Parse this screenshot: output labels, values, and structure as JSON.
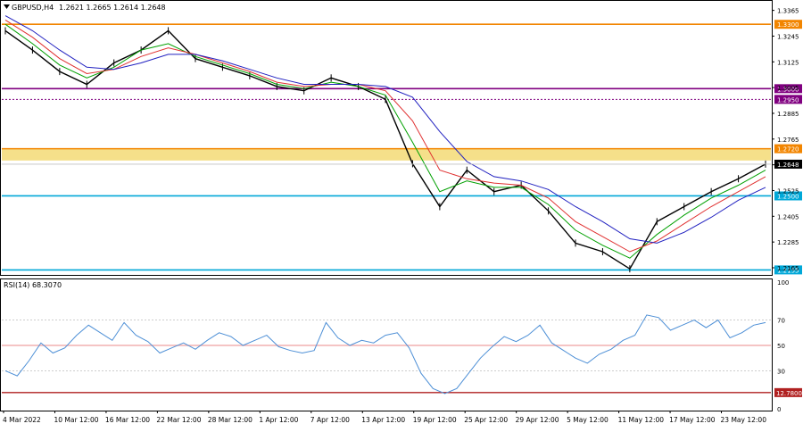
{
  "header": {
    "symbol": "GBPUSD,H4",
    "ohlc": "1.2621 1.2665 1.2614 1.2648"
  },
  "chart_data": [
    {
      "type": "line",
      "title": "GBPUSD,H4",
      "x": [
        "4 Mar 2022",
        "10 Mar 12:00",
        "16 Mar 12:00",
        "22 Mar 12:00",
        "28 Mar 12:00",
        "1 Apr 12:00",
        "7 Apr 12:00",
        "13 Apr 12:00",
        "19 Apr 12:00",
        "25 Apr 12:00",
        "29 Apr 12:00",
        "5 May 12:00",
        "11 May 12:00",
        "17 May 12:00",
        "23 May 12:00"
      ],
      "series": [
        {
          "type": "candlestick",
          "values": [
            1.327,
            1.318,
            1.308,
            1.302,
            1.312,
            1.318,
            1.327,
            1.314,
            1.31,
            1.306,
            1.301,
            1.299,
            1.305,
            1.301,
            1.295,
            1.265,
            1.245,
            1.262,
            1.252,
            1.255,
            1.243,
            1.228,
            1.224,
            1.216,
            1.238,
            1.245,
            1.252,
            1.258,
            1.2648
          ],
          "color": "#000000"
        },
        {
          "type": "moving-average",
          "color": "#00a000",
          "values": [
            1.33,
            1.321,
            1.311,
            1.305,
            1.31,
            1.318,
            1.321,
            1.315,
            1.311,
            1.307,
            1.302,
            1.3,
            1.303,
            1.301,
            1.297,
            1.275,
            1.252,
            1.257,
            1.254,
            1.254,
            1.246,
            1.234,
            1.227,
            1.221,
            1.232,
            1.241,
            1.249,
            1.255,
            1.262
          ]
        },
        {
          "type": "moving-average",
          "color": "#e03030",
          "values": [
            1.332,
            1.324,
            1.314,
            1.307,
            1.309,
            1.315,
            1.319,
            1.316,
            1.312,
            1.308,
            1.303,
            1.301,
            1.302,
            1.302,
            1.299,
            1.285,
            1.262,
            1.258,
            1.256,
            1.255,
            1.249,
            1.238,
            1.231,
            1.224,
            1.229,
            1.237,
            1.245,
            1.252,
            1.259
          ]
        },
        {
          "type": "moving-average",
          "color": "#2020c0",
          "values": [
            1.334,
            1.327,
            1.318,
            1.31,
            1.309,
            1.312,
            1.316,
            1.316,
            1.313,
            1.309,
            1.305,
            1.302,
            1.302,
            1.302,
            1.301,
            1.296,
            1.28,
            1.266,
            1.259,
            1.257,
            1.253,
            1.245,
            1.238,
            1.23,
            1.228,
            1.233,
            1.24,
            1.248,
            1.254
          ]
        }
      ],
      "y_ticks": [
        "1.3365",
        "1.3245",
        "1.3125",
        "1.3005",
        "1.2885",
        "1.2765",
        "1.2645",
        "1.2525",
        "1.2405",
        "1.2285",
        "1.2165"
      ],
      "ylim": [
        1.214,
        1.3405
      ],
      "levels": [
        {
          "label": "1.3300",
          "value": 1.33,
          "color": "#f28500"
        },
        {
          "label": "1.3000",
          "value": 1.3,
          "color": "#800080"
        },
        {
          "label": "1.2950",
          "value": 1.295,
          "color": "#800080",
          "style": "dotted"
        },
        {
          "label": "1.2720",
          "value": 1.272,
          "color": "#f28500"
        },
        {
          "label": "1.2500",
          "value": 1.25,
          "color": "#00a8d8"
        },
        {
          "label": "1.2155",
          "value": 1.2155,
          "color": "#00a8d8"
        }
      ],
      "zone": {
        "from": 1.2665,
        "to": 1.272,
        "color": "#f5e08a"
      },
      "price_label": "1.2648",
      "price_value": 1.2648,
      "grid": false
    },
    {
      "type": "line",
      "title": "RSI(14) 68.3070",
      "series": [
        {
          "name": "RSI(14)",
          "color": "#4d8fd6",
          "values": [
            30,
            26,
            38,
            52,
            44,
            48,
            58,
            66,
            60,
            54,
            68,
            58,
            53,
            44,
            48,
            52,
            47,
            54,
            60,
            57,
            50,
            54,
            58,
            49,
            46,
            44,
            46,
            68,
            56,
            50,
            54,
            52,
            58,
            60,
            48,
            28,
            16,
            12,
            16,
            28,
            40,
            49,
            57,
            53,
            58,
            66,
            52,
            46,
            40,
            36,
            43,
            47,
            54,
            58,
            74,
            72,
            62,
            66,
            70,
            64,
            70,
            56,
            60,
            66,
            68
          ]
        }
      ],
      "y_ticks": [
        "100",
        "70",
        "50",
        "30",
        "0"
      ],
      "ylim": [
        0,
        100
      ],
      "levels": [
        {
          "label": "70",
          "value": 70,
          "color": "#bbbbbb",
          "style": "dotted"
        },
        {
          "label": "50",
          "value": 50,
          "color": "#f2b0b0"
        },
        {
          "label": "30",
          "value": 30,
          "color": "#bbbbbb",
          "style": "dotted"
        },
        {
          "label": "12.7800",
          "value": 12.78,
          "color": "#b02020"
        }
      ],
      "grid": false
    }
  ]
}
